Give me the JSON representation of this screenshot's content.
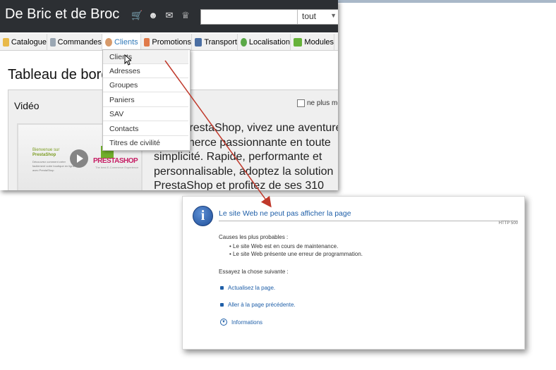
{
  "shop": {
    "title": "De Bric et de Broc"
  },
  "header": {
    "icons": [
      "cart-icon",
      "users-icon",
      "messages-icon",
      "trophy-icon"
    ],
    "search": {
      "value": "",
      "select_value": "tout"
    }
  },
  "tabs": [
    {
      "label": "Catalogue",
      "icon": "folder-icon"
    },
    {
      "label": "Commandes",
      "icon": "cart-icon"
    },
    {
      "label": "Clients",
      "icon": "user-icon"
    },
    {
      "label": "Promotions",
      "icon": "promotion-icon"
    },
    {
      "label": "Transport",
      "icon": "truck-icon"
    },
    {
      "label": "Localisation",
      "icon": "globe-icon"
    },
    {
      "label": "Modules",
      "icon": "puzzle-icon"
    }
  ],
  "dropdown": {
    "items": [
      "Clients",
      "Adresses",
      "Groupes",
      "Paniers",
      "SAV",
      "Contacts",
      "Titres de civilité"
    ]
  },
  "main": {
    "title": "Tableau de bord",
    "panel": {
      "title": "Vidéo",
      "checkbox_label": "ne plus me",
      "text": "Avec PrestaShop, vivez une aventure e-commerce passionnante en toute simplicité. Rapide, performante et personnalisable, adoptez la solution PrestaShop et profitez de ses 310",
      "video": {
        "bienvenue": "Bienvenue sur",
        "brand": "PrestaShop",
        "desc": "Découvrez comment créer facilement votre boutique en ligne avec PrestaShop",
        "logo": "PRESTASHOP",
        "logo_sub": "The best E-Commerce Experience"
      }
    }
  },
  "error": {
    "title": "Le site Web ne peut pas afficher la page",
    "http": "HTTP 500",
    "causes_label": "Causes les plus probables :",
    "causes": [
      "Le site Web est en cours de maintenance.",
      "Le site Web présente une erreur de programmation."
    ],
    "try_label": "Essayez la chose suivante :",
    "links": [
      "Actualisez la page.",
      "Aller à la page précédente."
    ],
    "info": "Informations"
  },
  "colors": {
    "header_bg": "#2c2f33",
    "link_blue": "#1f5fa8",
    "arrow": "#c0392b"
  }
}
